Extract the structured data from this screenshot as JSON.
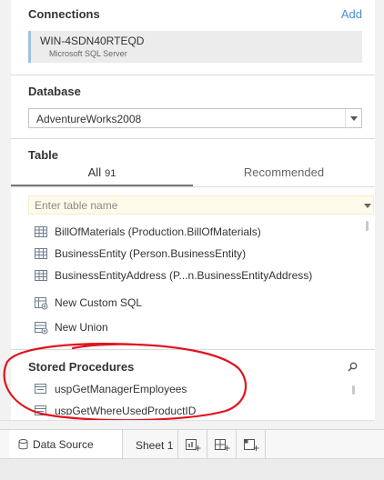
{
  "connections": {
    "title": "Connections",
    "add_label": "Add",
    "items": [
      {
        "name": "WIN-4SDN40RTEQD",
        "type": "Microsoft SQL Server"
      }
    ]
  },
  "database": {
    "title": "Database",
    "selected": "AdventureWorks2008"
  },
  "table": {
    "title": "Table",
    "tabs": [
      {
        "label": "All",
        "count": "91"
      },
      {
        "label": "Recommended"
      }
    ],
    "search_placeholder": "Enter table name",
    "items": [
      {
        "label": "BusinessEntity (Person.BusinessEntity)",
        "icon": "table-grid-icon"
      },
      {
        "label": "BusinessEntityAddress (P...n.BusinessEntityAddress)",
        "icon": "table-grid-icon"
      },
      {
        "label": "BillOfMaterials (Production.BillOfMaterials)",
        "icon": "table-grid-icon"
      }
    ],
    "actions": [
      {
        "label": "New Custom SQL",
        "icon": "custom-sql-icon"
      },
      {
        "label": "New Union",
        "icon": "union-icon"
      }
    ]
  },
  "stored_procedures": {
    "title": "Stored Procedures",
    "items": [
      {
        "label": "uspGetManagerEmployees",
        "icon": "procedure-icon"
      },
      {
        "label": "uspGetWhereUsedProductID",
        "icon": "procedure-icon"
      }
    ]
  },
  "annotation": {
    "color": "#e0141e"
  },
  "tabbar": {
    "data_source_label": "Data Source",
    "sheet_label": "Sheet 1"
  },
  "colors": {
    "accent_link": "#4a8fcf",
    "connection_bar": "#9fc1e4",
    "search_bg": "#fdfbe9"
  }
}
